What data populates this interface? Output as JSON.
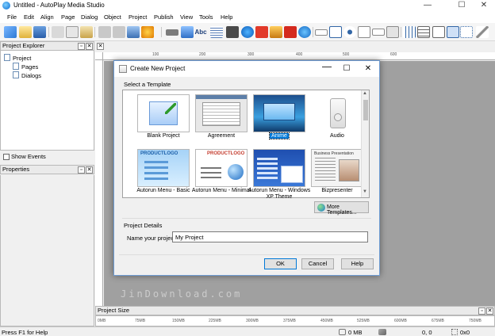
{
  "window": {
    "title": "Untitled - AutoPlay Media Studio",
    "minimize": "—",
    "maximize": "☐",
    "close": "✕"
  },
  "menu": [
    "File",
    "Edit",
    "Align",
    "Page",
    "Dialog",
    "Object",
    "Project",
    "Publish",
    "View",
    "Tools",
    "Help"
  ],
  "project_explorer": {
    "title": "Project Explorer",
    "pin": "▫",
    "close": "✕",
    "root": "Project",
    "children": [
      "Pages",
      "Dialogs"
    ],
    "show_events_label": "Show Events"
  },
  "properties": {
    "title": "Properties",
    "pin": "▫",
    "close": "✕"
  },
  "work_area": {
    "close": "✕"
  },
  "ruler": {
    "labels": [
      "100",
      "200",
      "300",
      "400",
      "500",
      "600"
    ]
  },
  "watermark": "JinDownload.com",
  "project_size": {
    "title": "Project Size",
    "pin": "▫",
    "close": "✕",
    "ticks": [
      "0MB",
      "75MB",
      "150MB",
      "225MB",
      "300MB",
      "375MB",
      "450MB",
      "525MB",
      "600MB",
      "675MB",
      "750MB"
    ]
  },
  "status_bar": {
    "help": "Press F1 for Help",
    "size": "0 MB",
    "coords": "0, 0",
    "dims": "0x0"
  },
  "dialog": {
    "title": "Create New Project",
    "minimize": "",
    "maximize": "☐",
    "close": "✕",
    "select_template_label": "Select a Template",
    "templates": [
      {
        "label": "Blank Project",
        "selected": false
      },
      {
        "label": "Agreement",
        "selected": false
      },
      {
        "label": "Anime",
        "selected": true
      },
      {
        "label": "Audio",
        "selected": false
      },
      {
        "label": "Autorun Menu - Basic",
        "selected": false
      },
      {
        "label": "Autorun Menu - Minimal",
        "selected": false
      },
      {
        "label": "Autorun Menu - Windows XP Theme",
        "selected": false
      },
      {
        "label": "Bizpresenter",
        "selected": false
      }
    ],
    "thumb_text": {
      "productlogo": "PRODUCTLOGO",
      "business_presentation": "Business Presentation"
    },
    "more_templates_label": "More Templates...",
    "project_details_label": "Project Details",
    "name_label": "Name your project:",
    "name_value": "My Project",
    "ok_label": "OK",
    "cancel_label": "Cancel",
    "help_label": "Help"
  },
  "colors": {
    "accent": "#0078d7",
    "canvas": "#a0a0a0",
    "dialog_border": "#6e9cd4"
  }
}
